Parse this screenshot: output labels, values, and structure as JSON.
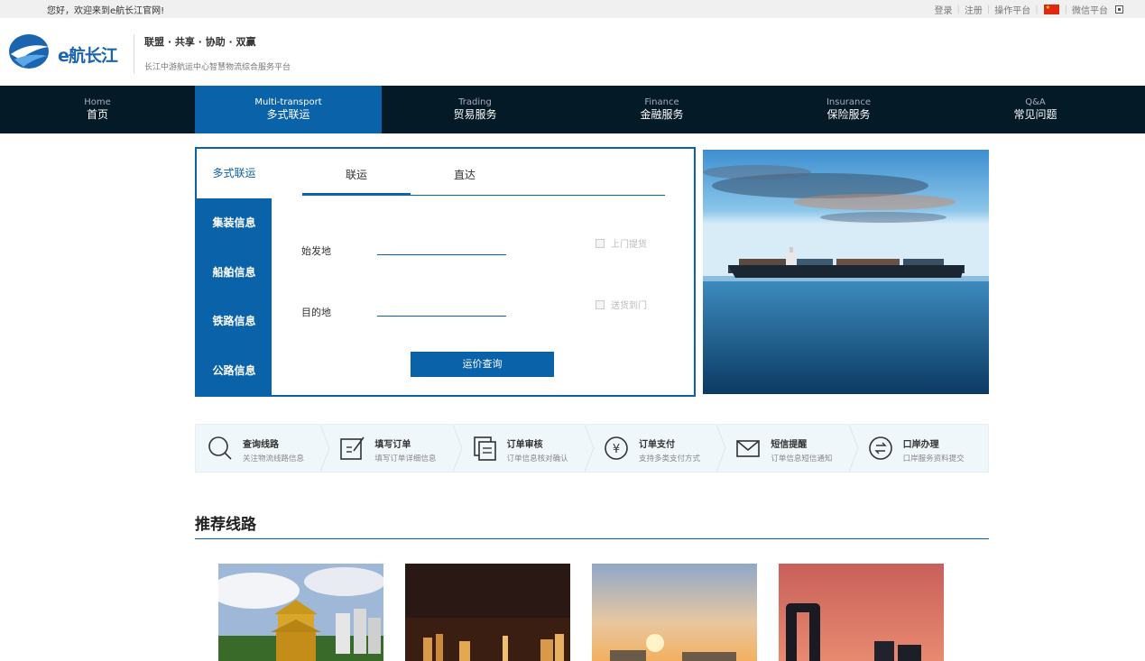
{
  "topbar": {
    "welcome": "您好，欢迎来到e航长江官网!",
    "login": "登录",
    "register": "注册",
    "ops": "操作平台",
    "wechat": "微信平台"
  },
  "header": {
    "logo_text": "e航长江",
    "slogan": "联盟 · 共享 · 协助 · 双赢",
    "subslogan": "长江中游航运中心智慧物流综合服务平台"
  },
  "nav": [
    {
      "en": "Home",
      "cn": "首页"
    },
    {
      "en": "Multi-transport",
      "cn": "多式联运"
    },
    {
      "en": "Trading",
      "cn": "贸易服务"
    },
    {
      "en": "Finance",
      "cn": "金融服务"
    },
    {
      "en": "Insurance",
      "cn": "保险服务"
    },
    {
      "en": "Q&A",
      "cn": "常见问题"
    }
  ],
  "side": [
    "多式联运",
    "集装信息",
    "船舶信息",
    "铁路信息",
    "公路信息"
  ],
  "tabs": [
    "联运",
    "直达"
  ],
  "form": {
    "origin_label": "始发地",
    "dest_label": "目的地",
    "pickup": "上门提货",
    "delivery": "送货到门",
    "query_button": "运价查询"
  },
  "steps": [
    {
      "title": "查询线路",
      "desc": "关注物流线路信息",
      "icon": "search-icon"
    },
    {
      "title": "填写订单",
      "desc": "填写订单详细信息",
      "icon": "edit-icon"
    },
    {
      "title": "订单审核",
      "desc": "订单信息核对确认",
      "icon": "document-icon"
    },
    {
      "title": "订单支付",
      "desc": "支持多类支付方式",
      "icon": "yen-icon"
    },
    {
      "title": "短信提醒",
      "desc": "订单信息短信通知",
      "icon": "mail-icon"
    },
    {
      "title": "口岸办理",
      "desc": "口岸服务资料提交",
      "icon": "exchange-icon"
    }
  ],
  "recommended": {
    "title": "推荐线路"
  },
  "colors": {
    "primary": "#0a62a8",
    "nav_bg": "#041a27"
  }
}
